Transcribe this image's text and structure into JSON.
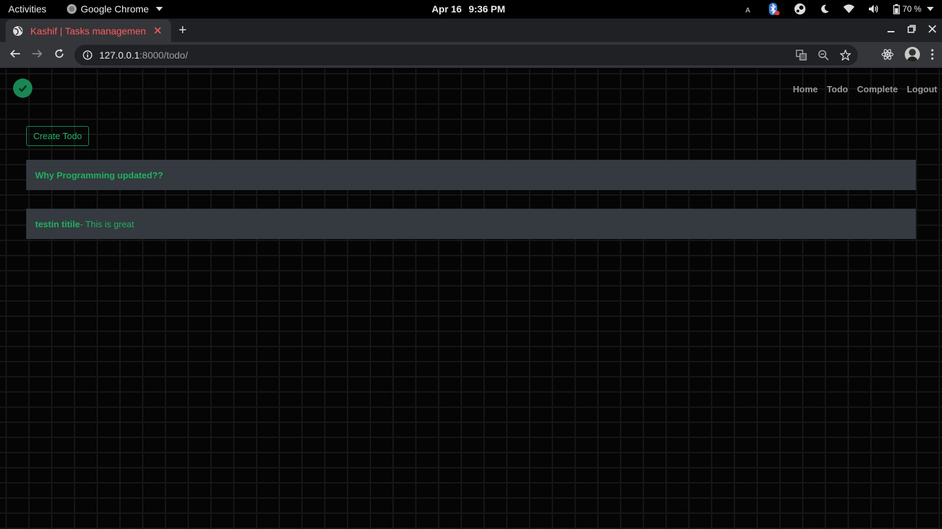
{
  "os_bar": {
    "activities": "Activities",
    "app_name": "Google Chrome",
    "date": "Apr 16",
    "time": "9:36 PM",
    "battery": "70 %"
  },
  "browser": {
    "tab_title": "Kashif | Tasks managemen",
    "url_host": "127.0.0.1",
    "url_path": ":8000/todo/"
  },
  "site": {
    "nav": [
      "Home",
      "Todo",
      "Complete",
      "Logout"
    ],
    "create_button": "Create Todo",
    "todos": [
      {
        "title": "Why Programming updated??",
        "description": ""
      },
      {
        "title": "testin titile",
        "description": " - This is great"
      }
    ]
  },
  "colors": {
    "accent_green": "#198754",
    "text_green": "#1fb15e",
    "card_bg": "#343a40",
    "tab_title": "#ff5c5c"
  }
}
